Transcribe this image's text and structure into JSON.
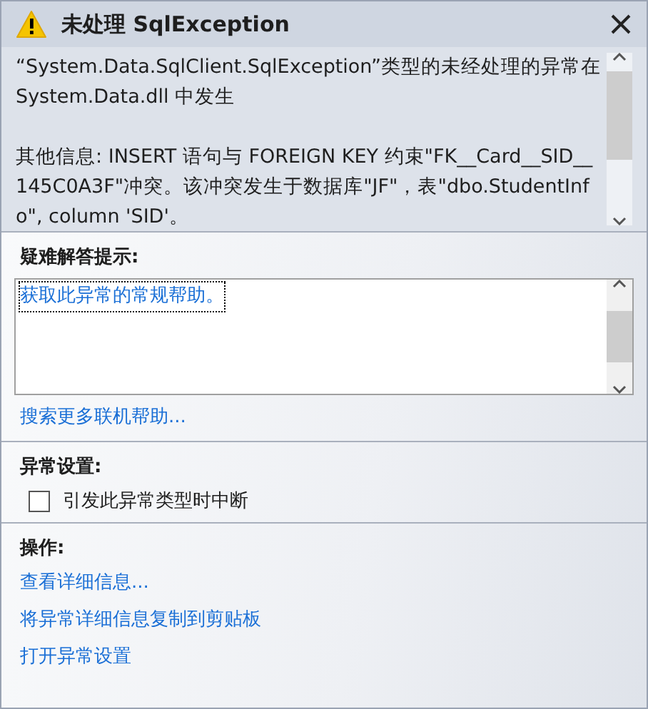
{
  "window": {
    "title": "未处理 SqlException"
  },
  "message": {
    "paragraphs": [
      "“System.Data.SqlClient.SqlException”类型的未经处理的异常在 System.Data.dll 中发生",
      "其他信息: INSERT 语句与 FOREIGN KEY 约束\"FK__Card__SID__145C0A3F\"冲突。该冲突发生于数据库\"JF\"，表\"dbo.StudentInfo\", column 'SID'。"
    ]
  },
  "troubleshooting": {
    "heading": "疑难解答提示:",
    "tips": [
      {
        "text": "获取此异常的常规帮助。",
        "focused": true
      }
    ],
    "more_link": "搜索更多联机帮助..."
  },
  "exception_settings": {
    "heading": "异常设置:",
    "checkbox": {
      "label": "引发此异常类型时中断",
      "checked": false
    }
  },
  "actions": {
    "heading": "操作:",
    "links": [
      "查看详细信息...",
      "将异常详细信息复制到剪贴板",
      "打开异常设置"
    ]
  }
}
